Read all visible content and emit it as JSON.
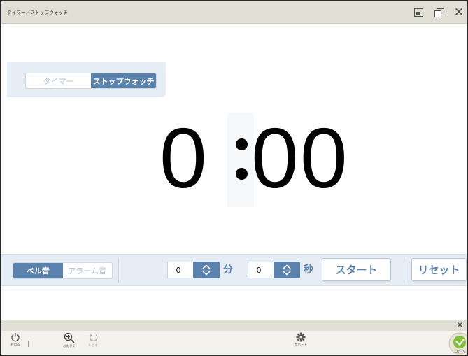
{
  "window": {
    "title": "タイマー／ストップウォッチ"
  },
  "mode_tabs": [
    {
      "label": "タイマー",
      "active": false
    },
    {
      "label": "ストップウォッチ",
      "active": true
    }
  ],
  "display": {
    "minutes": "0",
    "seconds": "00"
  },
  "sound_tabs": [
    {
      "label": "ベル音",
      "active": true
    },
    {
      "label": "アラーム音",
      "active": false
    }
  ],
  "minutes_input": {
    "value": "0",
    "unit": "分"
  },
  "seconds_input": {
    "value": "0",
    "unit": "秒"
  },
  "buttons": {
    "start": "スタート",
    "reset": "リセット"
  },
  "toolbar": {
    "power_label": "おわる",
    "zoom_label": "おおきく",
    "undo_label": "もどす",
    "support_label": "サポート",
    "next_label": "つぎへ"
  },
  "colors": {
    "accent": "#5a82ad",
    "panel": "#e6edf4",
    "titlebar": "#e1e0d7"
  }
}
